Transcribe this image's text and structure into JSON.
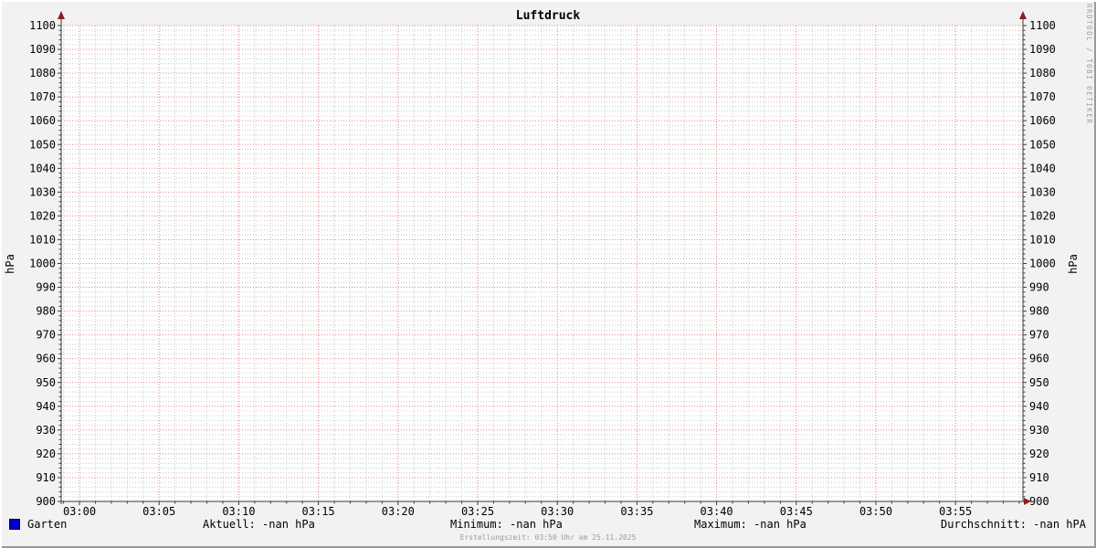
{
  "title": "Luftdruck",
  "watermark": "RRDTOOL / TOBI OETIKER",
  "footer": "Erstellungszeit: 03:50 Uhr am 25.11.2025",
  "legend": {
    "label": "Garten",
    "swatch_color": "#0000cc"
  },
  "stats": [
    {
      "label": "Aktuell:",
      "value": "-nan hPa"
    },
    {
      "label": "Minimum:",
      "value": "-nan hPa"
    },
    {
      "label": "Maximum:",
      "value": "-nan hPa"
    },
    {
      "label": "Durchschnitt:",
      "value": "-nan hPA"
    }
  ],
  "axis": {
    "left_label": "hPa",
    "right_label": "hPa"
  },
  "colors": {
    "background": "#f2f2f2",
    "canvas": "#ffffff",
    "major_grid": "#e88080",
    "minor_grid": "#cbcbcb",
    "axis": "#3a3a3a",
    "arrow": "#8b2020",
    "series": "#0000cc",
    "muted_text": "#9b9b9b"
  },
  "chart_data": {
    "type": "line",
    "title": "Luftdruck",
    "ylabel": "hPa",
    "ylabel_right": "hPa",
    "ylim": [
      900,
      1100
    ],
    "y_major_step": 10,
    "y_minor_step": 2,
    "x_tick_labels": [
      "03:00",
      "03:05",
      "03:10",
      "03:15",
      "03:20",
      "03:25",
      "03:30",
      "03:35",
      "03:40",
      "03:45",
      "03:50",
      "03:55"
    ],
    "x_major_step_minutes": 5,
    "x_minor_step_minutes": 1,
    "grid": true,
    "legend_position": "bottom",
    "series": [
      {
        "name": "Garten",
        "color": "#0000cc",
        "unit": "hPa",
        "current": "-nan",
        "minimum": "-nan",
        "maximum": "-nan",
        "average": "-nan",
        "values": []
      }
    ],
    "notes": "no data plotted (all values -nan)"
  }
}
